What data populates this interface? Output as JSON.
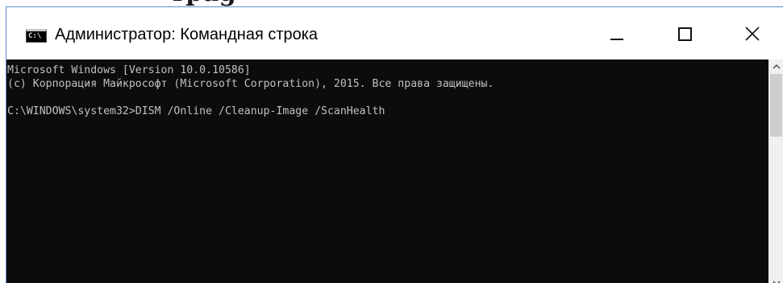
{
  "page": {
    "heading_fragment": "rpag"
  },
  "window": {
    "title": "Администратор: Командная строка",
    "icon_text": "C:\\",
    "icons": {
      "app": "cmd-app-icon",
      "minimize": "minimize-icon",
      "maximize": "maximize-icon",
      "close": "close-icon",
      "scroll_up": "chevron-up-icon",
      "scroll_down": "chevron-down-icon"
    }
  },
  "console": {
    "lines": [
      "Microsoft Windows [Version 10.0.10586]",
      "(c) Корпорация Майкрософт (Microsoft Corporation), 2015. Все права защищены.",
      "C:\\WINDOWS\\system32>DISM /Online /Cleanup-Image /ScanHealth"
    ],
    "colors": {
      "background": "#0c0c0c",
      "text": "#c0c0c0"
    }
  },
  "colors": {
    "window_border": "#5a8fc7",
    "titlebar": "#ffffff",
    "scrollbar_track": "#f0f0f0",
    "scrollbar_thumb": "#cdcdcd"
  }
}
